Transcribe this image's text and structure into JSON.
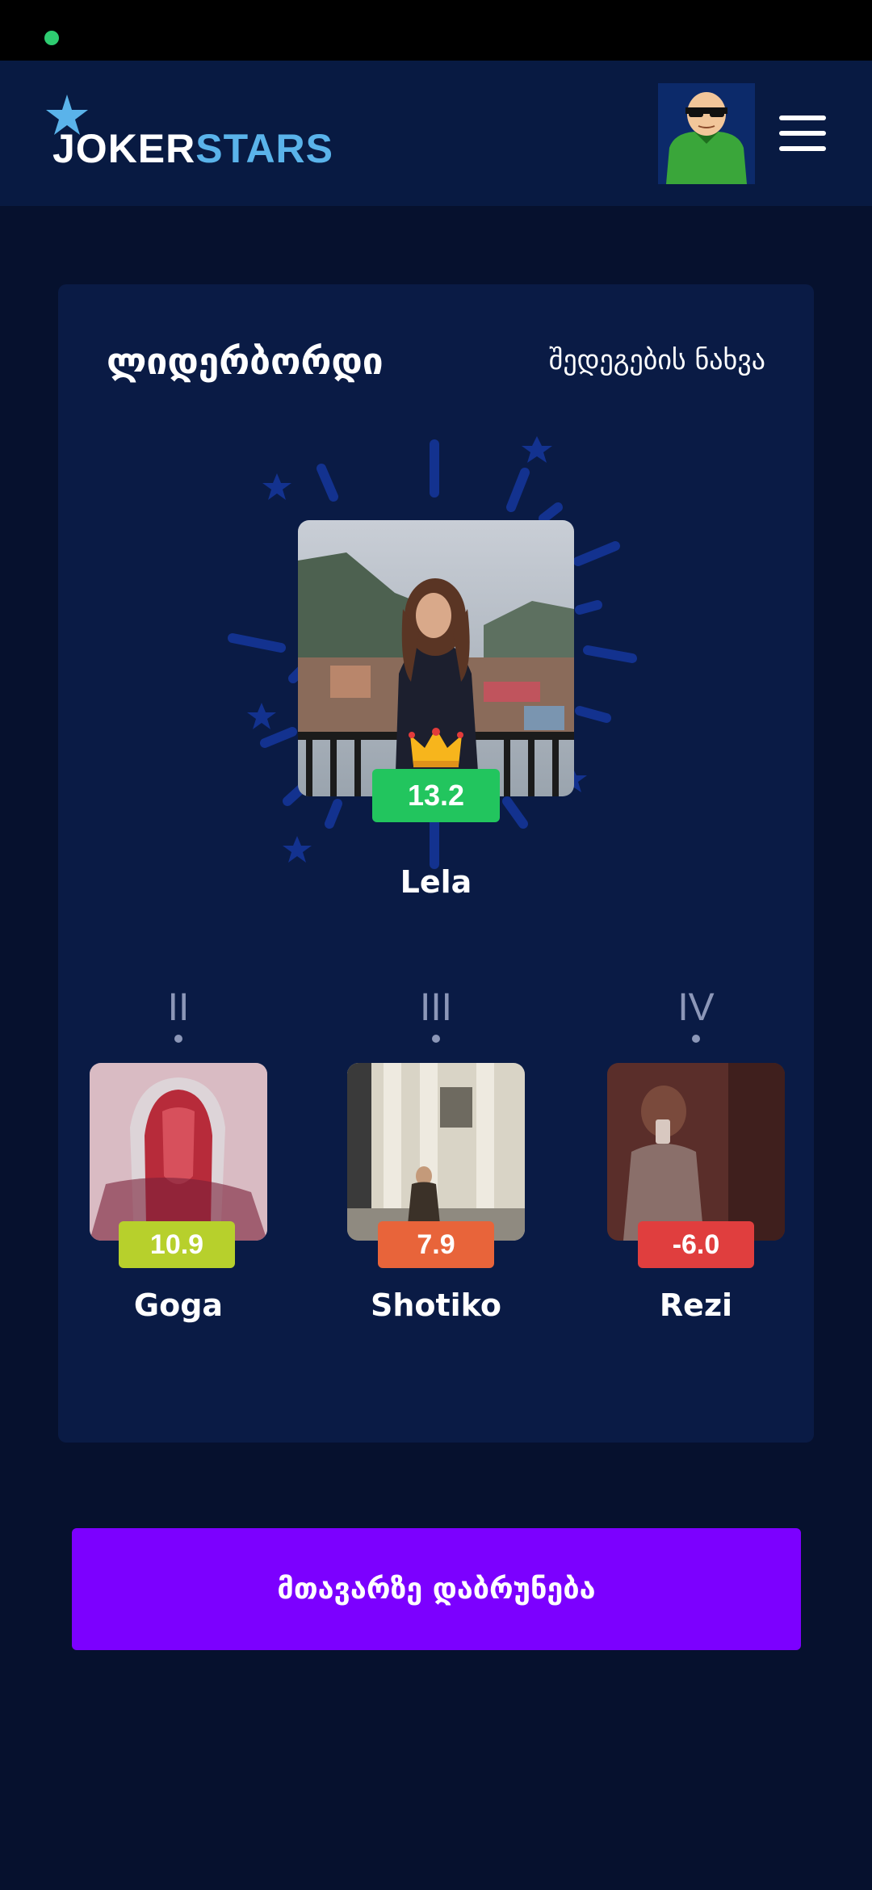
{
  "logo": {
    "part1": "JOKER",
    "part2": "STARS"
  },
  "header": {
    "avatar_icon": "avatar-icon",
    "menu_icon": "hamburger-menu-icon"
  },
  "leaderboard": {
    "title": "ლიდერბორდი",
    "results_link": "შედეგების ნახვა",
    "leader": {
      "name": "Lela",
      "score": "13.2",
      "score_color": "#22c55e"
    },
    "runners_up": [
      {
        "rank": "II",
        "name": "Goga",
        "score": "10.9",
        "score_color": "#b7d02c"
      },
      {
        "rank": "III",
        "name": "Shotiko",
        "score": "7.9",
        "score_color": "#e8643a"
      },
      {
        "rank": "IV",
        "name": "Rezi",
        "score": "-6.0",
        "score_color": "#e03e3e"
      }
    ]
  },
  "back_button": {
    "label": "მთავარზე დაბრუნება"
  },
  "colors": {
    "background": "#06112e",
    "card": "#0a1b45",
    "accent": "#7c00ff"
  }
}
